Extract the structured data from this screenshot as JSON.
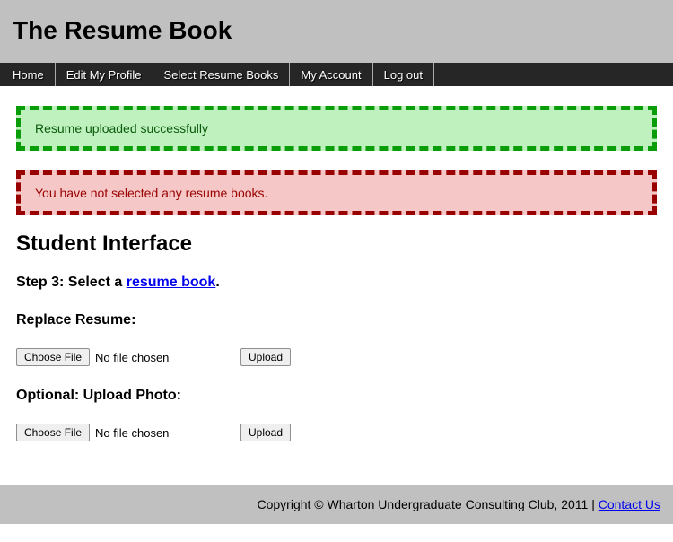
{
  "header": {
    "title": "The Resume Book"
  },
  "nav": {
    "items": [
      "Home",
      "Edit My Profile",
      "Select Resume Books",
      "My Account",
      "Log out"
    ]
  },
  "messages": {
    "success": "Resume uploaded successfully",
    "error": "You have not selected any resume books."
  },
  "page_title": "Student Interface",
  "step": {
    "prefix": "Step 3: Select a ",
    "link_text": "resume book",
    "suffix": "."
  },
  "sections": {
    "replace_resume": "Replace Resume:",
    "upload_photo": "Optional: Upload Photo:"
  },
  "file": {
    "choose_label": "Choose File",
    "no_file": "No file chosen",
    "upload_label": "Upload"
  },
  "footer": {
    "text": "Copyright © Wharton Undergraduate Consulting Club, 2011 | ",
    "contact": "Contact Us"
  }
}
